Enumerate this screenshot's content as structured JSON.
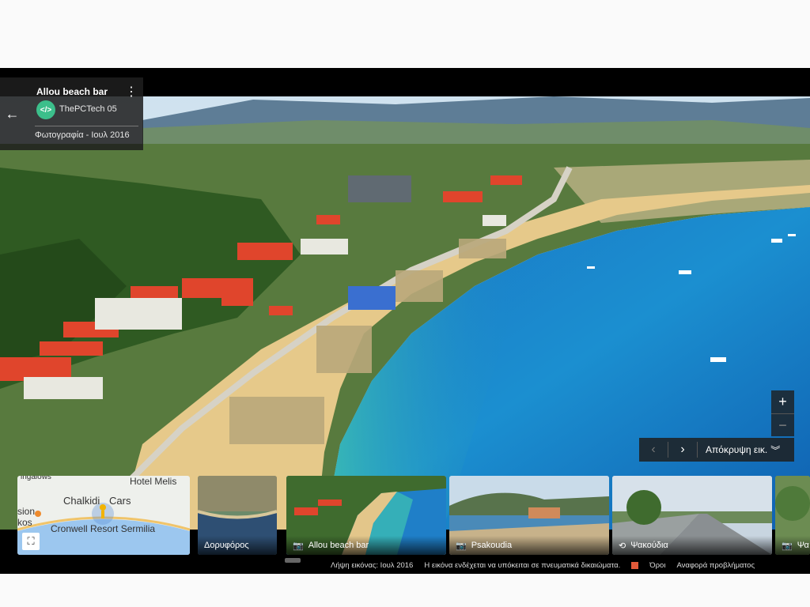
{
  "info_card": {
    "title": "Allou beach bar",
    "author": "ThePCTech 05",
    "author_initials": "</>",
    "date": "Φωτογραφία - Ιουλ 2016",
    "menu_icon": "more-vert-icon",
    "back_icon": "arrow-left-icon"
  },
  "zoom": {
    "in": "+",
    "out": "−"
  },
  "nav": {
    "prev": "‹",
    "next": "›",
    "hide_label": "Απόκρυψη εικ.",
    "hide_chevron": "︾"
  },
  "map_thumb": {
    "labels": {
      "top_left": "ingalows",
      "hotel": "Hotel Melis",
      "place": "Chalkidi",
      "cars": "Cars",
      "resort": "Cronwell Resort Sermilia",
      "left1": "sion",
      "left2": "kos"
    },
    "expand_icon": "fullscreen-icon"
  },
  "thumbnails": [
    {
      "label": "Δορυφόρος",
      "icon": ""
    },
    {
      "label": "Allou beach bar",
      "icon": "camera-icon"
    },
    {
      "label": "Psakoudia",
      "icon": "camera-icon"
    },
    {
      "label": "Ψακούδια",
      "icon": "360-icon"
    },
    {
      "label": "Ψα",
      "icon": "camera-icon"
    }
  ],
  "footer": {
    "capture": "Λήψη εικόνας: Ιουλ 2016",
    "copyright": "Η εικόνα ενδέχεται να υπόκειται σε πνευματικά δικαιώματα.",
    "terms": "Όροι",
    "report": "Αναφορά προβλήματος"
  },
  "colors": {
    "accent_green": "#3cbf8b",
    "sea": "#1b86c9",
    "roof": "#e0452c"
  }
}
